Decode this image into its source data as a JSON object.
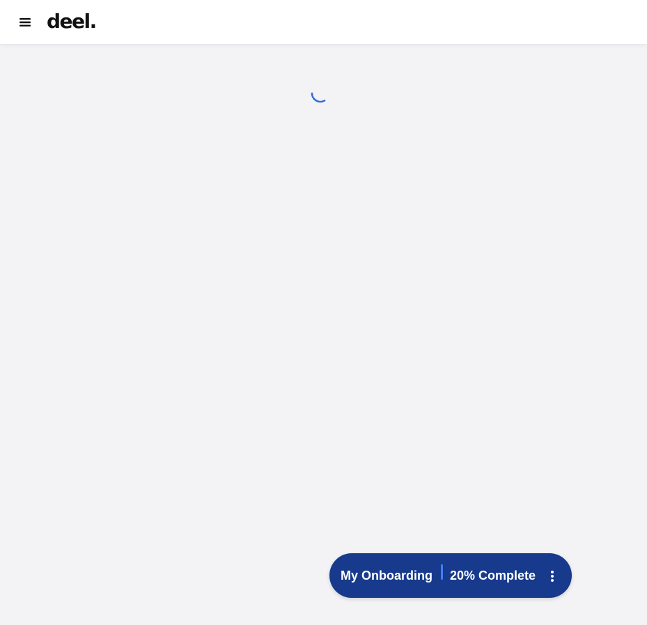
{
  "header": {
    "logo_text": "deel.",
    "menu_icon": "hamburger-menu-icon"
  },
  "loading": {
    "icon": "loading-spinner-icon",
    "color": "#2f6fe0"
  },
  "onboarding": {
    "title": "My Onboarding",
    "progress_label": "20% Complete",
    "progress_percent": 20,
    "more_icon": "vertical-dots-icon",
    "background": "#173a8c",
    "divider_color": "#3f7ef4"
  },
  "colors": {
    "page_background": "#f3f3f6",
    "header_background": "#ffffff"
  }
}
